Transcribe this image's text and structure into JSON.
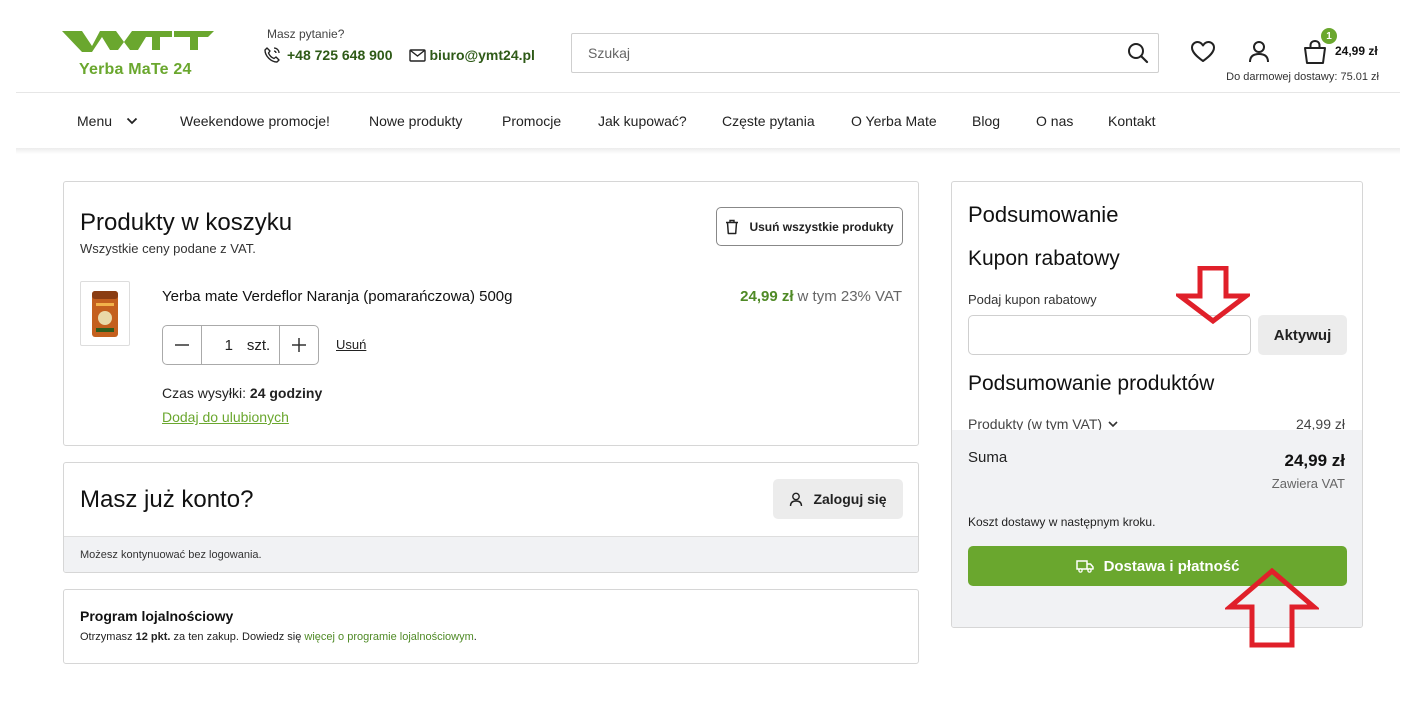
{
  "header": {
    "logo_text": "Yerba MaTe 24",
    "contact_question": "Masz pytanie?",
    "phone": "+48 725 648 900",
    "email": "biuro@ymt24.pl",
    "search_placeholder": "Szukaj",
    "cart_count": "1",
    "cart_total": "24,99 zł",
    "free_shipping": "Do darmowej dostawy: 75.01 zł"
  },
  "nav": {
    "menu_label": "Menu",
    "items": [
      "Weekendowe promocje!",
      "Nowe produkty",
      "Promocje",
      "Jak kupować?",
      "Częste pytania",
      "O Yerba Mate",
      "Blog",
      "O nas",
      "Kontakt"
    ]
  },
  "cart": {
    "title": "Produkty w koszyku",
    "subtitle": "Wszystkie ceny podane z VAT.",
    "clear_all": "Usuń wszystkie produkty",
    "product": {
      "name": "Yerba mate Verdeflor Naranja (pomarańczowa) 500g",
      "price": "24,99 zł",
      "vat_note": "w tym 23% VAT",
      "quantity": "1",
      "unit": "szt.",
      "remove": "Usuń",
      "ship_label": "Czas wysyłki:",
      "ship_value": "24 godziny",
      "add_fav": "Dodaj do ulubionych"
    }
  },
  "account": {
    "title": "Masz już konto?",
    "login": "Zaloguj się",
    "guest_note": "Możesz kontynuować bez logowania."
  },
  "loyalty": {
    "title": "Program lojalnościowy",
    "text_before": "Otrzymasz",
    "points": "12 pkt.",
    "text_middle": "za ten zakup. Dowiedz się",
    "link": "więcej o programie lojalnościowym",
    "text_after": "."
  },
  "summary": {
    "title": "Podsumowanie",
    "coupon_title": "Kupon rabatowy",
    "coupon_label": "Podaj kupon rabatowy",
    "coupon_value": "",
    "activate": "Aktywuj",
    "products_title": "Podsumowanie produktów",
    "products_label": "Produkty (w tym VAT)",
    "products_value": "24,99 zł",
    "total_label": "Suma",
    "total_value": "24,99 zł",
    "total_vat": "Zawiera VAT",
    "shipping_note": "Koszt dostawy w następnym kroku.",
    "checkout": "Dostawa i płatność"
  },
  "colors": {
    "brand_green": "#6aa72e",
    "annotation_red": "#e0202a"
  }
}
